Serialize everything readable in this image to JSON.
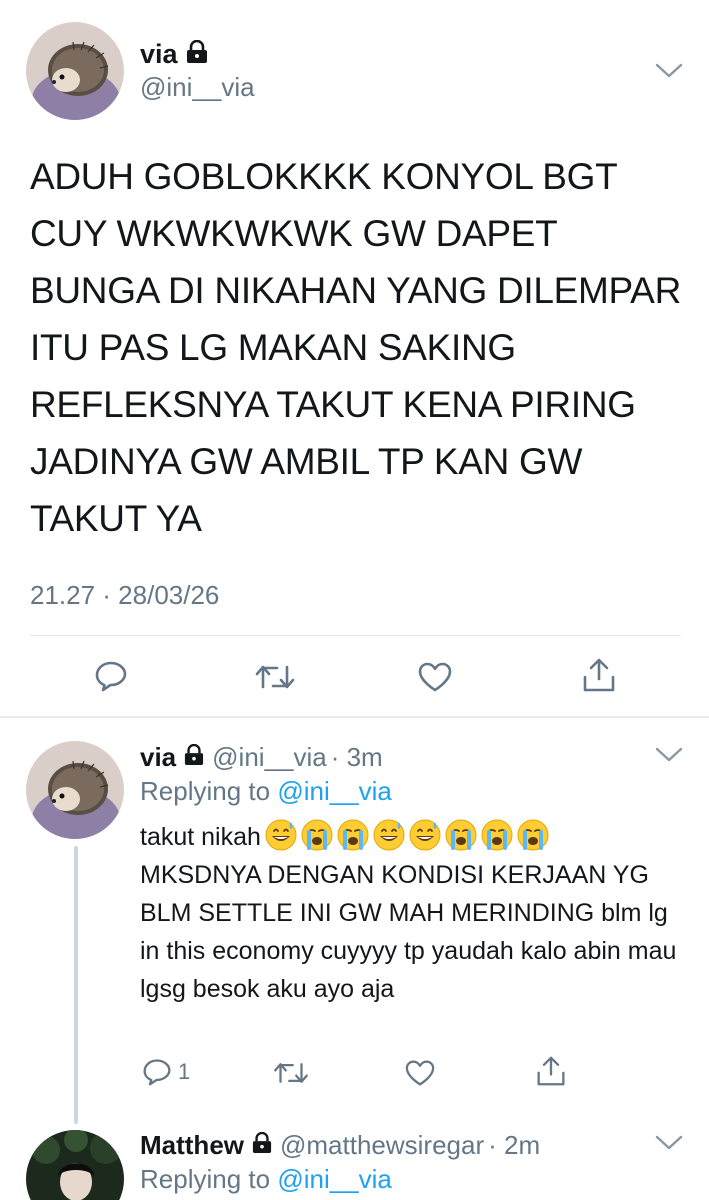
{
  "main_tweet": {
    "name": "via",
    "handle": "@ini__via",
    "text": "ADUH GOBLOKKKK KONYOL BGT CUY WKWKWKWK GW DAPET BUNGA DI NIKAHAN YANG DILEMPAR ITU PAS LG MAKAN SAKING REFLEKSNYA TAKUT KENA PIRING JADINYA GW AMBIL TP KAN GW TAKUT YA",
    "timestamp": "21.27 · 28/03/26",
    "icons": [
      "reply-icon",
      "retweet-icon",
      "like-icon",
      "share-icon"
    ]
  },
  "reply1": {
    "name": "via",
    "handle": "@ini__via",
    "time": "· 3m",
    "replying_prefix": "Replying to ",
    "replying_to": "@ini__via",
    "text_start": "takut nikah",
    "emojis": [
      "sweat-smile",
      "loudly-crying",
      "loudly-crying",
      "sweat-smile",
      "sweat-smile",
      "loudly-crying",
      "loudly-crying",
      "loudly-crying"
    ],
    "text": "MKSDNYA DENGAN KONDISI KERJAAN YG BLM SETTLE INI GW MAH MERINDING blm lg in this economy cuyyyy tp yaudah kalo abin mau lgsg besok aku ayo aja",
    "reply_count": "1"
  },
  "reply2": {
    "name": "Matthew",
    "handle": "@matthewsiregar",
    "time": "· 2m",
    "replying_prefix": "Replying to ",
    "replying_to": "@ini__via"
  },
  "colors": {
    "text": "#14171a",
    "secondary": "#657786",
    "link": "#1da1f2",
    "divider": "#e1e8ed",
    "thread_line": "#ccd6dd"
  }
}
